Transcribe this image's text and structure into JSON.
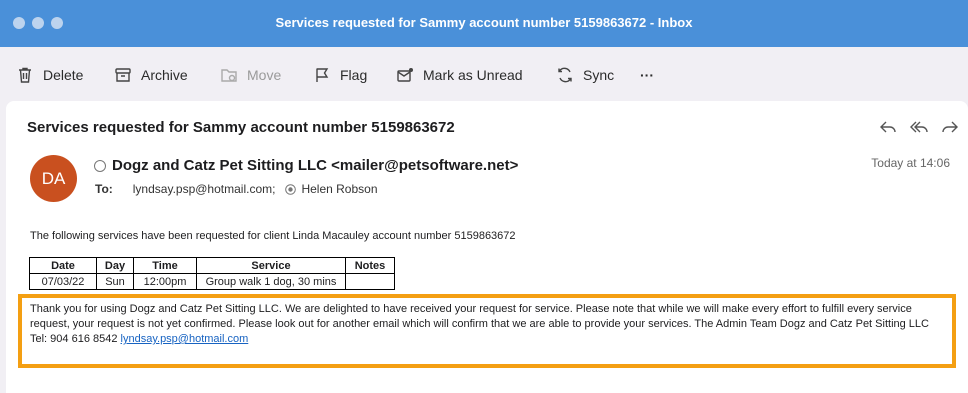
{
  "window": {
    "title": "Services requested for Sammy account number 5159863672 - Inbox"
  },
  "toolbar": {
    "delete": "Delete",
    "archive": "Archive",
    "move": "Move",
    "flag": "Flag",
    "mark_unread": "Mark as Unread",
    "sync": "Sync",
    "more": "···"
  },
  "message": {
    "subject": "Services requested for Sammy account number 5159863672",
    "avatar_initials": "DA",
    "avatar_color": "#c9501f",
    "sender": "Dogz and Catz Pet Sitting LLC <mailer@petsoftware.net>",
    "to_label": "To:",
    "recipients": [
      "lyndsay.psp@hotmail.com;",
      "Helen Robson"
    ],
    "timestamp": "Today at 14:06",
    "intro": "The following services have been requested for client Linda Macauley account number 5159863672",
    "table": {
      "headers": [
        "Date",
        "Day",
        "Time",
        "Service",
        "Notes"
      ],
      "rows": [
        [
          "07/03/22",
          "Sun",
          "12:00pm",
          "Group walk 1 dog, 30 mins",
          ""
        ]
      ]
    },
    "notice_text": "Thank you for using Dogz and Catz Pet Sitting LLC. We are delighted to have received your request for service. Please note that while we will make every effort to fulfill every service request, your request is not yet confirmed. Please look out for another email which will confirm that we are able to provide your services. The Admin Team Dogz and Catz Pet Sitting LLC Tel: 904 616 8542",
    "notice_link": "lyndsay.psp@hotmail.com",
    "highlight_color": "#f49f12"
  },
  "colors": {
    "titlebar": "#4a90d9",
    "link": "#1763c2"
  }
}
